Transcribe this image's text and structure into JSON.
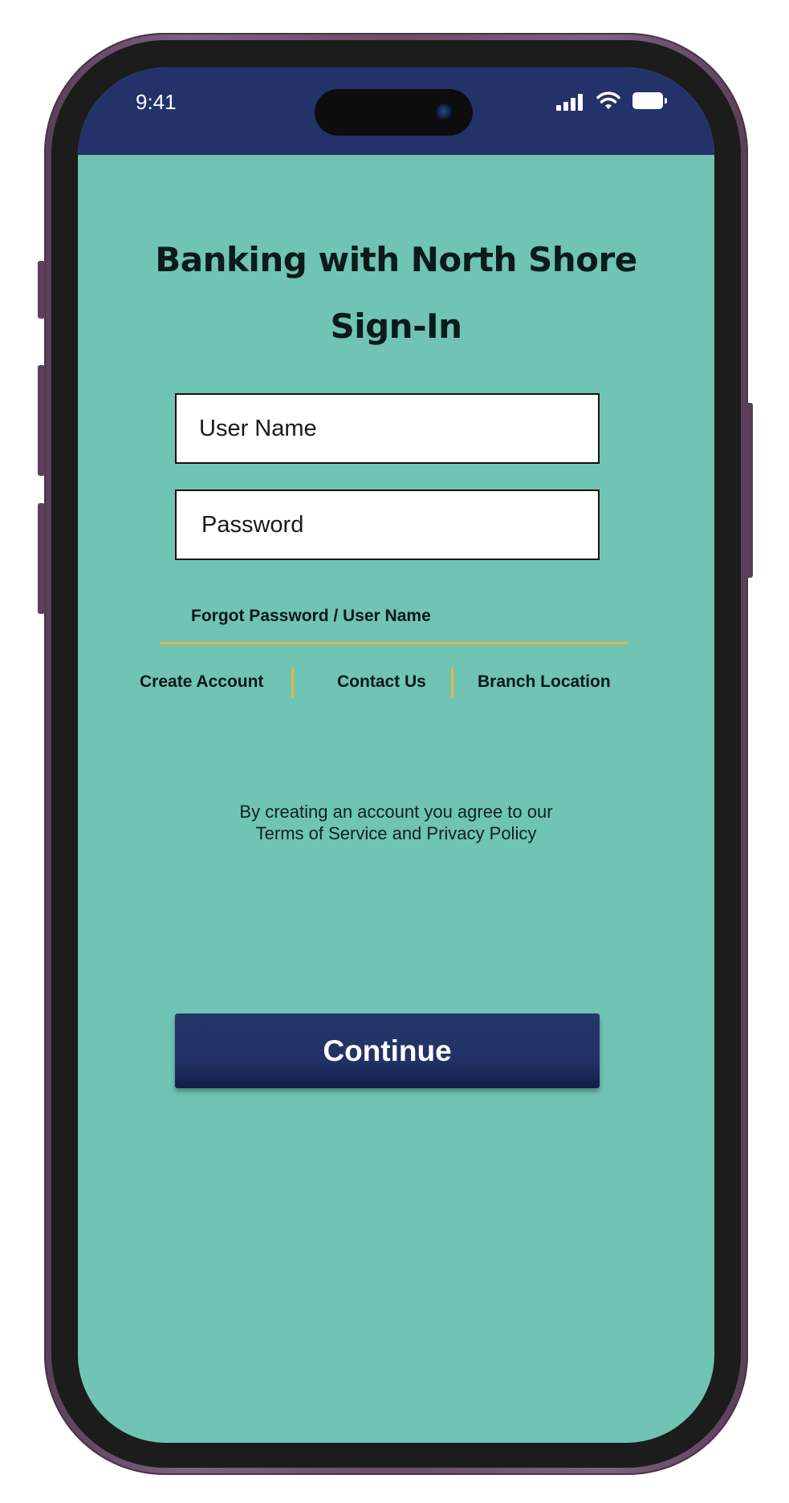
{
  "status_bar": {
    "time": "9:41",
    "icons": [
      "signal-icon",
      "wifi-icon",
      "battery-icon"
    ]
  },
  "signin": {
    "title": "Banking with North Shore",
    "subtitle": "Sign-In",
    "username_placeholder": "User Name",
    "password_placeholder": "Password",
    "forgot_label": "Forgot Password / User Name",
    "links": {
      "create_account": "Create Account",
      "contact_us": "Contact Us",
      "branch_location": "Branch Location"
    },
    "terms_line1": "By creating an account you agree to our",
    "terms_line2": "Terms of Service and Privacy Policy",
    "continue_label": "Continue"
  },
  "colors": {
    "background": "#6fc4b3",
    "status_bar": "#23336a",
    "accent_gold": "#e6b44a",
    "button": "#223266",
    "phone_frame": "#6a4d68"
  }
}
